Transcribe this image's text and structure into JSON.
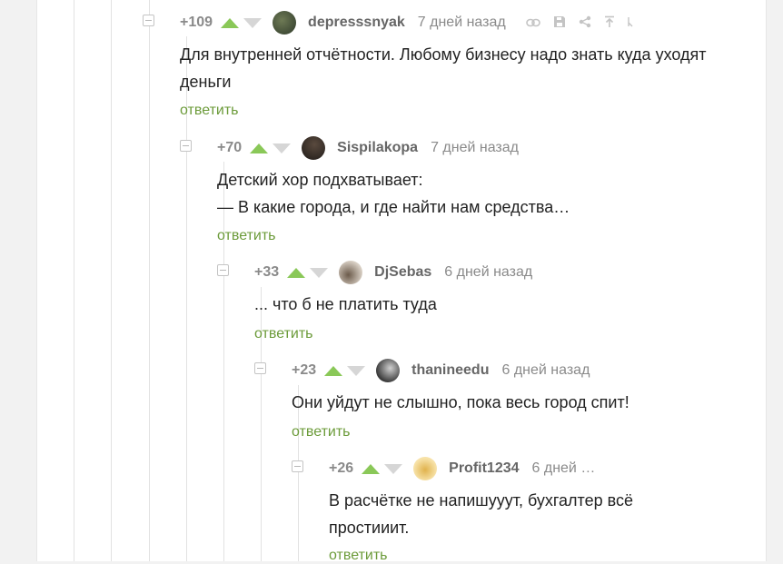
{
  "comments": [
    {
      "rating": "+109",
      "author": "depresssnyak",
      "time": "7 дней назад",
      "lines": [
        "Для внутренней отчётности. Любому бизнесу надо знать куда уходят",
        "деньги"
      ],
      "reply_label": "ответить",
      "avatar_colors": [
        "#6e7a55",
        "#2f3a2a"
      ],
      "icons": [
        "link-icon",
        "save-icon",
        "share-icon",
        "pin-top-icon"
      ]
    },
    {
      "rating": "+70",
      "author": "Sispilakopa",
      "time": "7 дней назад",
      "lines": [
        "Детский хор подхватывает:",
        "— В какие города, и где найти нам средства…"
      ],
      "reply_label": "ответить",
      "avatar_colors": [
        "#5a4a3e",
        "#1e1a18"
      ]
    },
    {
      "rating": "+33",
      "author": "DjSebas",
      "time": "6 дней назад",
      "lines": [
        "... что б не платить туда"
      ],
      "reply_label": "ответить",
      "avatar_colors": [
        "#d8cfc4",
        "#6b5a4a"
      ]
    },
    {
      "rating": "+23",
      "author": "thanineedu",
      "time": "6 дней назад",
      "lines": [
        "Они уйдут не слышно, пока весь город спит!"
      ],
      "reply_label": "ответить",
      "avatar_colors": [
        "#9a9a9a",
        "#3a3a3a"
      ]
    },
    {
      "rating": "+26",
      "author": "Profit1234",
      "time": "6 дней …",
      "lines": [
        "В расчётке не напишууут, бухгалтер всё",
        "простииит."
      ],
      "reply_label": "ответить",
      "avatar_colors": [
        "#f7e2a8",
        "#e0b24c"
      ]
    }
  ],
  "colors": {
    "upvote": "#8ac858",
    "downvote": "#d6d6d6",
    "reply": "#6c9b3a",
    "text": "#222222",
    "meta": "#8a8a8a"
  }
}
